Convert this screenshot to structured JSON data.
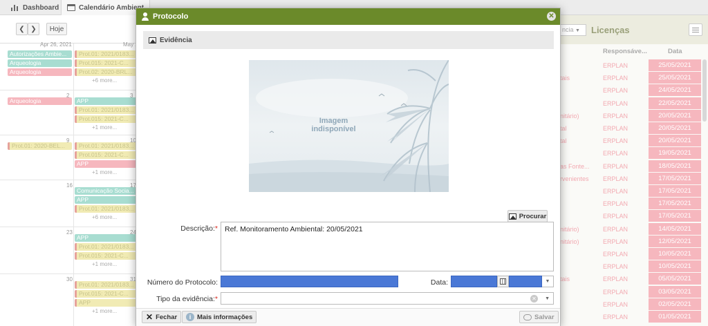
{
  "tabs": [
    {
      "label": "Dashboard",
      "icon": "bar-chart-icon"
    },
    {
      "label": "Calendário Ambient",
      "icon": "calendar-icon"
    }
  ],
  "calendar": {
    "nav_prev": "❮",
    "nav_next": "❯",
    "today_label": "Hoje",
    "col_heads": [
      "Apr 26, 2021",
      "May 2"
    ],
    "weeks": [
      {
        "days": [
          "",
          ""
        ],
        "left_events": [
          {
            "text": "Autorizações Ambie...",
            "color": "teal"
          },
          {
            "text": "Arqueologia",
            "color": "teal"
          },
          {
            "text": "Arqueologia",
            "color": "pink"
          }
        ],
        "right_events": [
          {
            "text": "Prot.01: 2021/0183...",
            "color": "yellow"
          },
          {
            "text": "Prot.015: 2021-C...",
            "color": "yellow"
          },
          {
            "text": "Prot.02: 2020-BRL...",
            "color": "yellow"
          }
        ],
        "more_left": "",
        "more_right": "+6 more..."
      },
      {
        "days": [
          "2",
          "3"
        ],
        "left_events": [
          {
            "text": "Arqueologia",
            "color": "pink"
          }
        ],
        "right_events": [
          {
            "text": "APP",
            "color": "teal"
          },
          {
            "text": "Prot.01: 2021/0183...",
            "color": "yellow"
          },
          {
            "text": "Prot.015: 2021-C...",
            "color": "yellow"
          }
        ],
        "more_left": "",
        "more_right": "+1 more..."
      },
      {
        "days": [
          "9",
          "10"
        ],
        "left_events": [
          {
            "text": "Prot.01: 2020-BEL...",
            "color": "yellow"
          }
        ],
        "right_events": [
          {
            "text": "Prot.01: 2021/0183...",
            "color": "yellow"
          },
          {
            "text": "Prot.015: 2021-C...",
            "color": "yellow"
          },
          {
            "text": "APP",
            "color": "pink"
          }
        ],
        "more_left": "",
        "more_right": "+1 more..."
      },
      {
        "days": [
          "16",
          "17"
        ],
        "left_events": [],
        "right_events": [
          {
            "text": "Comunicação Socia...",
            "color": "teal"
          },
          {
            "text": "APP",
            "color": "teal"
          },
          {
            "text": "Prot.01: 2021/0183...",
            "color": "yellow"
          }
        ],
        "more_left": "",
        "more_right": "+6 more..."
      },
      {
        "days": [
          "23",
          "24"
        ],
        "left_events": [],
        "right_events": [
          {
            "text": "APP",
            "color": "teal"
          },
          {
            "text": "Prot.01: 2021/0183...",
            "color": "yellow"
          },
          {
            "text": "Prot.015: 2021-C...",
            "color": "yellow"
          }
        ],
        "more_left": "",
        "more_right": "+1 more..."
      },
      {
        "days": [
          "30",
          "31"
        ],
        "left_events": [],
        "right_events": [
          {
            "text": "Prot.01: 2021/0183...",
            "color": "yellow"
          },
          {
            "text": "Prot.015: 2021-C...",
            "color": "yellow"
          },
          {
            "text": "APP",
            "color": "yellow"
          }
        ],
        "more_left": "",
        "more_right": "+1 more..."
      }
    ]
  },
  "right_panel": {
    "select_value": "ncia",
    "title": "Licenças",
    "col_resp": "Responsáve...",
    "col_date": "Data",
    "rows": [
      {
        "desc": "",
        "resp": "ERPLAN",
        "date": "25/05/2021"
      },
      {
        "desc": "tais",
        "resp": "ERPLAN",
        "date": "25/05/2021"
      },
      {
        "desc": "",
        "resp": "ERPLAN",
        "date": "24/05/2021"
      },
      {
        "desc": "",
        "resp": "ERPLAN",
        "date": "22/05/2021"
      },
      {
        "desc": "nitário)",
        "resp": "ERPLAN",
        "date": "20/05/2021"
      },
      {
        "desc": "tal",
        "resp": "ERPLAN",
        "date": "20/05/2021"
      },
      {
        "desc": "tal",
        "resp": "ERPLAN",
        "date": "20/05/2021"
      },
      {
        "desc": "",
        "resp": "ERPLAN",
        "date": "19/05/2021"
      },
      {
        "desc": "as Fonte...",
        "resp": "ERPLAN",
        "date": "18/05/2021"
      },
      {
        "desc": "rvenientes",
        "resp": "ERPLAN",
        "date": "17/05/2021"
      },
      {
        "desc": "",
        "resp": "ERPLAN",
        "date": "17/05/2021"
      },
      {
        "desc": "",
        "resp": "ERPLAN",
        "date": "17/05/2021"
      },
      {
        "desc": "",
        "resp": "ERPLAN",
        "date": "17/05/2021"
      },
      {
        "desc": "nitário)",
        "resp": "ERPLAN",
        "date": "14/05/2021"
      },
      {
        "desc": "nitário)",
        "resp": "ERPLAN",
        "date": "12/05/2021"
      },
      {
        "desc": "",
        "resp": "ERPLAN",
        "date": "10/05/2021"
      },
      {
        "desc": "",
        "resp": "ERPLAN",
        "date": "10/05/2021"
      },
      {
        "desc": "tais",
        "resp": "ERPLAN",
        "date": "05/05/2021"
      },
      {
        "desc": "",
        "resp": "ERPLAN",
        "date": "03/05/2021"
      },
      {
        "desc": "",
        "resp": "ERPLAN",
        "date": "02/05/2021"
      },
      {
        "desc": "",
        "resp": "ERPLAN",
        "date": "01/05/2021"
      }
    ]
  },
  "dialog": {
    "title": "Protocolo",
    "close_glyph": "✕",
    "evidence_title": "Evidência",
    "image_placeholder_line1": "Imagem",
    "image_placeholder_line2": "indisponível",
    "browse_label": "Procurar",
    "description_label": "Descrição:",
    "description_value": "Ref. Monitoramento Ambiental: 20/05/2021",
    "protocol_label": "Número do Protocolo:",
    "protocol_value": "",
    "date_label": "Data:",
    "date_value": "",
    "time_value": "",
    "evidence_type_label": "Tipo da evidência:",
    "evidence_type_value": "",
    "required_marker": "*",
    "close_button": "Fechar",
    "more_info_button": "Mais informações",
    "save_button": "Salvar"
  },
  "colors": {
    "title_bar": "#6b8a2a",
    "selection_blue": "#4a78d6",
    "date_badge": "#f6b7be",
    "event_teal": "#a8ddd1",
    "event_pink": "#f6b7be",
    "event_yellow": "#f1ebb4"
  }
}
